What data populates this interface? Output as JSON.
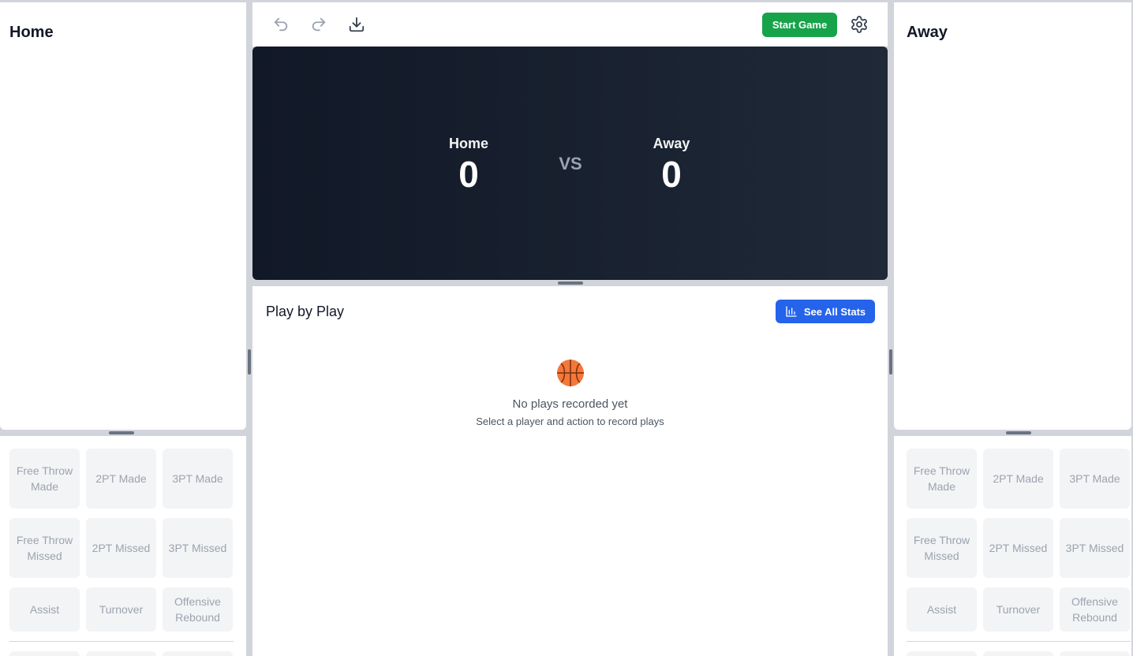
{
  "home": {
    "title": "Home",
    "actions": [
      "Free Throw Made",
      "2PT Made",
      "3PT Made",
      "Free Throw Missed",
      "2PT Missed",
      "3PT Missed",
      "Assist",
      "Turnover",
      "Offensive Rebound"
    ]
  },
  "away": {
    "title": "Away",
    "actions": [
      "Free Throw Made",
      "2PT Made",
      "3PT Made",
      "Free Throw Missed",
      "2PT Missed",
      "3PT Missed",
      "Assist",
      "Turnover",
      "Offensive Rebound"
    ]
  },
  "toolbar": {
    "icons": [
      "undo-icon",
      "redo-icon",
      "download-icon",
      "gear-icon"
    ],
    "start_label": "Start Game",
    "start_color": "#16a34a"
  },
  "scoreboard": {
    "home_name": "Home",
    "home_score": "0",
    "vs": "VS",
    "away_name": "Away",
    "away_score": "0"
  },
  "pbp": {
    "title": "Play by Play",
    "stats_label": "See All Stats",
    "stats_color": "#2563eb",
    "empty_icon": "basketball-icon",
    "empty_title": "No plays recorded yet",
    "empty_subtitle": "Select a player and action to record plays"
  }
}
